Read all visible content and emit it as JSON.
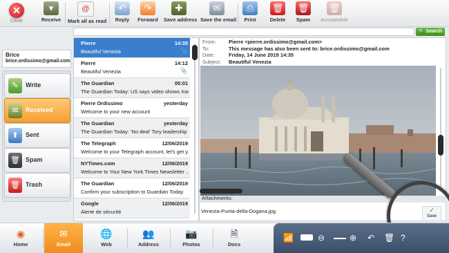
{
  "toolbar": {
    "close_label": "Close",
    "buttons": [
      {
        "label": "Receive"
      },
      {
        "label": "Mark all as read"
      },
      {
        "label": "Reply"
      },
      {
        "label": "Forward"
      },
      {
        "label": "Save address"
      },
      {
        "label": "Save the email"
      },
      {
        "label": "Print"
      },
      {
        "label": "Delete"
      },
      {
        "label": "Spam"
      },
      {
        "label": "Acceptable"
      }
    ]
  },
  "search": {
    "placeholder": "",
    "button_label": "Search"
  },
  "user": {
    "name": "Brice",
    "email": "brice.ordissimo@gmail.com"
  },
  "folders": [
    {
      "label": "Write"
    },
    {
      "label": "Received"
    },
    {
      "label": "Sent"
    },
    {
      "label": "Spam"
    },
    {
      "label": "Trash"
    }
  ],
  "messages": [
    {
      "sender": "Pierre",
      "date": "14:35",
      "subject": "Beautiful Venezia"
    },
    {
      "sender": "Pierre",
      "date": "14:12",
      "subject": "Beautiful Venezia"
    },
    {
      "sender": "The Guardian",
      "date": "05:01",
      "subject": "The Guardian Today: US says video shows Iran..."
    },
    {
      "sender": "Pierre Ordissimo",
      "date": "yesterday",
      "subject": "Welcome to your new account"
    },
    {
      "sender": "The Guardian",
      "date": "yesterday",
      "subject": "The Guardian Today: 'No deal' Tory leadership ..."
    },
    {
      "sender": "The Telegraph",
      "date": "12/06/2019",
      "subject": "Welcome to your Telegraph account, let's get y..."
    },
    {
      "sender": "NYTimes.com",
      "date": "12/06/2019",
      "subject": "Welcome to Your New York Times Newsletter ..."
    },
    {
      "sender": "The Guardian",
      "date": "12/06/2019",
      "subject": "Confirm your subscription to Guardian Today"
    },
    {
      "sender": "Google",
      "date": "12/06/2019",
      "subject": "Alerte de sécurité"
    }
  ],
  "email": {
    "from_label": "From:",
    "from": "Pierre <pierre.ordissimo@gmail.com>",
    "to_label": "To:",
    "to": "This message has also been sent to: brice.ordissimo@gmail.com",
    "date_label": "Date:",
    "date": "Friday, 14 June 2019 14:35",
    "subject_label": "Subject:",
    "subject": "Beautiful Venezia",
    "attachments_label": "Attachments:",
    "attachment_file": "Venezia-Punta-della-Dogana.jpg",
    "save_label": "Save"
  },
  "bottom_nav": [
    {
      "label": "Home"
    },
    {
      "label": "Email"
    },
    {
      "label": "Web"
    },
    {
      "label": "Address"
    },
    {
      "label": "Photos"
    },
    {
      "label": "Docs"
    }
  ]
}
